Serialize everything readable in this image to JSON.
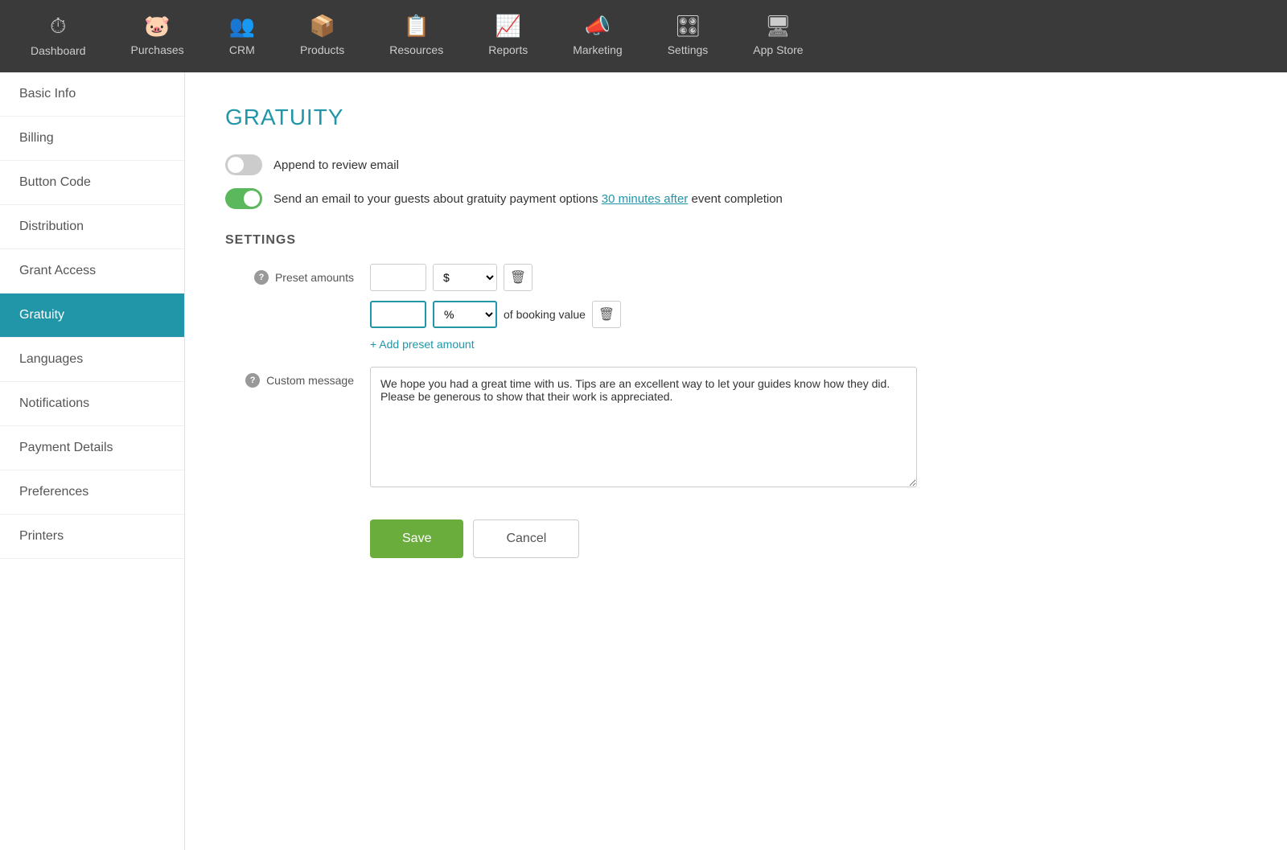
{
  "nav": {
    "items": [
      {
        "id": "dashboard",
        "label": "Dashboard",
        "icon": "⏱"
      },
      {
        "id": "purchases",
        "label": "Purchases",
        "icon": "🐷"
      },
      {
        "id": "crm",
        "label": "CRM",
        "icon": "👥"
      },
      {
        "id": "products",
        "label": "Products",
        "icon": "📦"
      },
      {
        "id": "resources",
        "label": "Resources",
        "icon": "📋"
      },
      {
        "id": "reports",
        "label": "Reports",
        "icon": "📈"
      },
      {
        "id": "marketing",
        "label": "Marketing",
        "icon": "📣"
      },
      {
        "id": "settings",
        "label": "Settings",
        "icon": "🎛"
      },
      {
        "id": "appstore",
        "label": "App Store",
        "icon": "🖥"
      }
    ]
  },
  "sidebar": {
    "items": [
      {
        "id": "basic-info",
        "label": "Basic Info"
      },
      {
        "id": "billing",
        "label": "Billing"
      },
      {
        "id": "button-code",
        "label": "Button Code"
      },
      {
        "id": "distribution",
        "label": "Distribution"
      },
      {
        "id": "grant-access",
        "label": "Grant Access"
      },
      {
        "id": "gratuity",
        "label": "Gratuity",
        "active": true
      },
      {
        "id": "languages",
        "label": "Languages"
      },
      {
        "id": "notifications",
        "label": "Notifications"
      },
      {
        "id": "payment-details",
        "label": "Payment Details"
      },
      {
        "id": "preferences",
        "label": "Preferences"
      },
      {
        "id": "printers",
        "label": "Printers"
      }
    ]
  },
  "content": {
    "page_title": "GRATUITY",
    "settings_title": "SETTINGS",
    "toggle1": {
      "label": "Append to review email",
      "checked": false
    },
    "toggle2": {
      "label_before": "Send an email to your guests about gratuity payment options",
      "link_text": "30 minutes after",
      "label_after": "event completion",
      "checked": true
    },
    "preset_amounts": {
      "help": "?",
      "label": "Preset amounts",
      "row1": {
        "input_value": "",
        "select_value": "$",
        "select_options": [
          "$",
          "%"
        ],
        "delete_icon": "🗑"
      },
      "row2": {
        "input_value": "",
        "select_value": "%",
        "select_options": [
          "$",
          "%"
        ],
        "suffix": "of booking value",
        "delete_icon": "🗑"
      },
      "add_link": "+ Add preset amount"
    },
    "custom_message": {
      "help": "?",
      "label": "Custom message",
      "value": "We hope you had a great time with us. Tips are an excellent way to let your guides know how they did. Please be generous to show that their work is appreciated."
    },
    "buttons": {
      "save": "Save",
      "cancel": "Cancel"
    }
  }
}
